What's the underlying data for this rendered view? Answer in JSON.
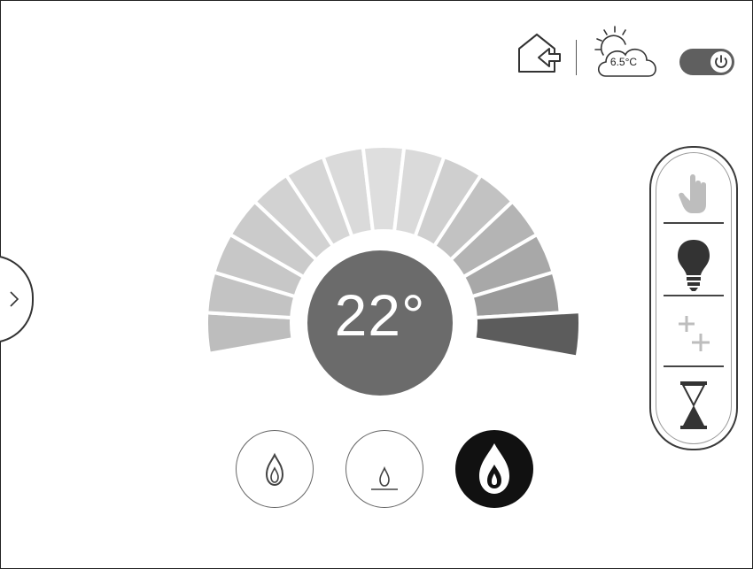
{
  "header": {
    "icons": {
      "home": "home-return-icon",
      "weather": "sun-cloud-icon",
      "power": "power-icon"
    },
    "weather_temp": "6.5°C",
    "power_on": true
  },
  "thermostat": {
    "temperature": "22°",
    "dial_segments_total": 15,
    "active_segment_index": 14
  },
  "modes": {
    "items": [
      {
        "icon": "hand-manual-icon",
        "state": "disabled"
      },
      {
        "icon": "lightbulb-icon",
        "state": "enabled"
      },
      {
        "icon": "plus-plus-icon",
        "state": "disabled"
      },
      {
        "icon": "hourglass-icon",
        "state": "enabled"
      }
    ]
  },
  "flame_modes": {
    "items": [
      {
        "icon": "flame-icon",
        "active": false
      },
      {
        "icon": "small-flame-icon",
        "active": false
      },
      {
        "icon": "large-flame-icon",
        "active": true
      }
    ]
  },
  "colors": {
    "segment_light": "#d9d9d9",
    "segment_mid": "#b0b0b0",
    "segment_dark": "#8a8a8a",
    "segment_active": "#5c5c5c",
    "center": "#6b6b6b"
  }
}
